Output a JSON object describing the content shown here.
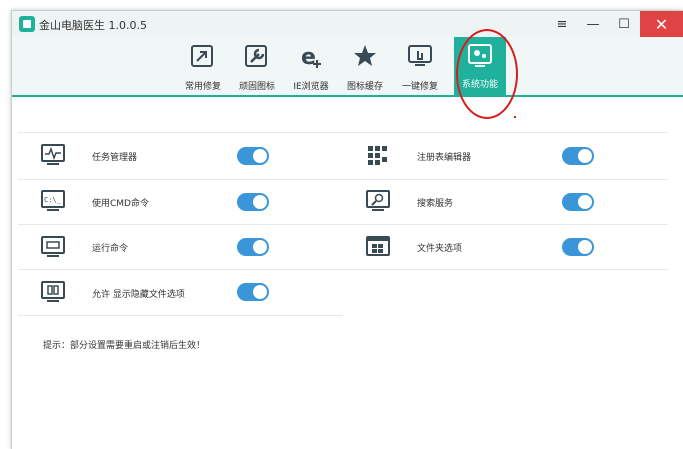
{
  "window": {
    "title": "金山电脑医生 1.0.0.5",
    "menu_icon": "≡",
    "minimize_icon": "—",
    "maximize_icon": "☐",
    "close_icon": "✕"
  },
  "toolbar": {
    "items": [
      {
        "label": "常用修复",
        "icon": "arrow-box-icon",
        "active": false
      },
      {
        "label": "顽固图标",
        "icon": "wrench-icon",
        "active": false
      },
      {
        "label": "IE浏览器",
        "icon": "ie-icon",
        "active": false
      },
      {
        "label": "图标缓存",
        "icon": "star-icon",
        "active": false
      },
      {
        "label": "一键修复",
        "icon": "hand-monitor-icon",
        "active": false
      },
      {
        "label": "系统功能",
        "icon": "gear-monitor-icon",
        "active": true
      }
    ]
  },
  "settings": {
    "left": [
      {
        "label": "任务管理器",
        "icon": "task-manager-icon",
        "on": true
      },
      {
        "label": "使用CMD命令",
        "icon": "cmd-icon",
        "on": true
      },
      {
        "label": "运行命令",
        "icon": "run-icon",
        "on": true
      },
      {
        "label": "允许 显示隐藏文件选项",
        "icon": "hidden-files-icon",
        "on": true
      }
    ],
    "right": [
      {
        "label": "注册表编辑器",
        "icon": "registry-icon",
        "on": true
      },
      {
        "label": "搜索服务",
        "icon": "search-service-icon",
        "on": true
      },
      {
        "label": "文件夹选项",
        "icon": "folder-options-icon",
        "on": true
      }
    ]
  },
  "tip": "提示：部分设置需要重启或注销后生效！",
  "colors": {
    "accent": "#1fb19b",
    "toggle_on": "#3a96d8",
    "close_button": "#e04343",
    "annotation": "#d91c1c"
  }
}
